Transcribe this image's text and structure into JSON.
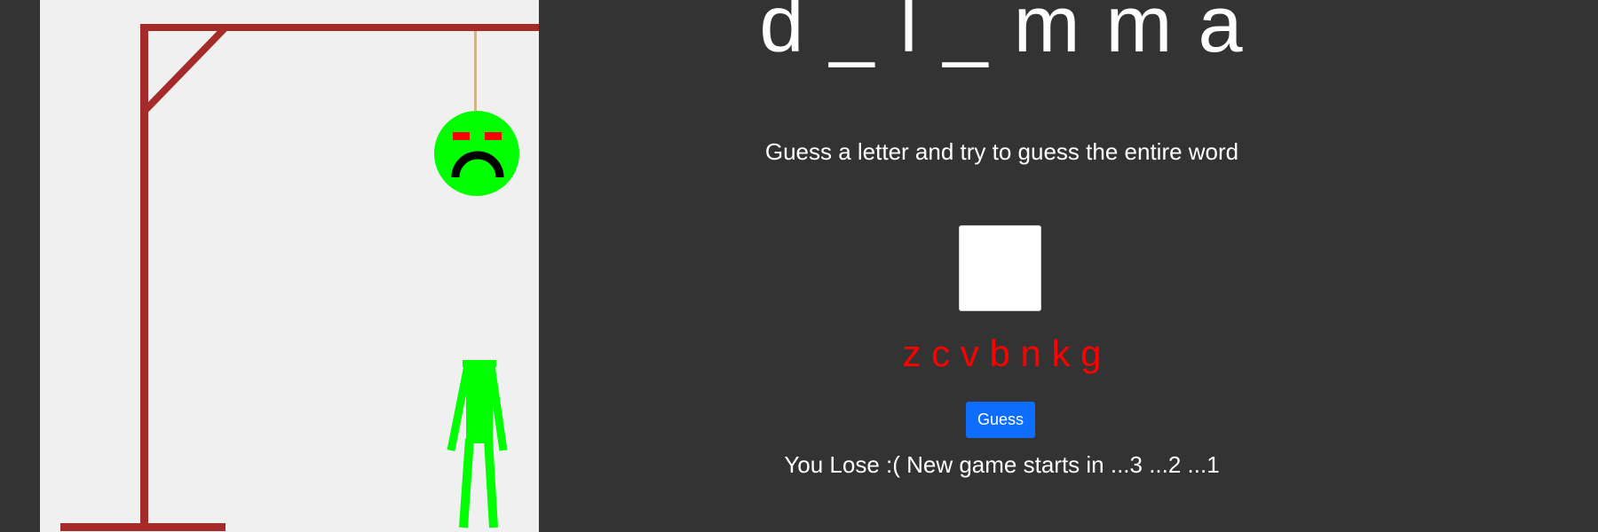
{
  "game": {
    "word_display": "d _ l _ m m a",
    "instruction": "Guess a letter and try to guess the entire word",
    "guess_input": {
      "value": "",
      "placeholder": ""
    },
    "wrong_letters": "z c v b n k g",
    "guess_button_label": "Guess",
    "status_message": "You Lose :( New game starts in ...3 ...2 ...1"
  },
  "colors": {
    "background": "#333333",
    "gallows_panel": "#f0f0f0",
    "gallows_wood": "#a52a2a",
    "rope": "#d2b48c",
    "figure": "#00ff00",
    "eyes": "#ff0000",
    "wrong_letters": "#ff0000",
    "button": "#0d6efd"
  }
}
